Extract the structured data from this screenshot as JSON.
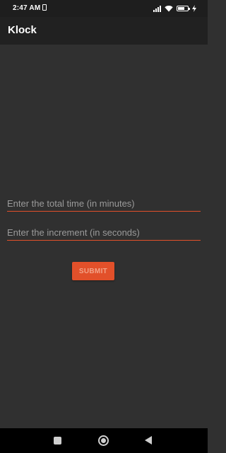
{
  "status_bar": {
    "time": "2:47 AM",
    "battery_level": 0.7,
    "icons": [
      "sim-card-icon",
      "signal-icon",
      "wifi-icon",
      "battery-icon",
      "charging-icon"
    ]
  },
  "app_bar": {
    "title": "Klock"
  },
  "form": {
    "total_time": {
      "value": "",
      "placeholder": "Enter the total time (in minutes)"
    },
    "increment": {
      "value": "",
      "placeholder": "Enter the increment (in seconds)"
    },
    "submit_label": "SUBMIT"
  },
  "nav_bar": {
    "icons": [
      "recents-icon",
      "home-icon",
      "back-icon"
    ]
  },
  "colors": {
    "background": "#303030",
    "app_bar": "#212121",
    "accent": "#e2502a",
    "placeholder": "#9a9a9a"
  }
}
